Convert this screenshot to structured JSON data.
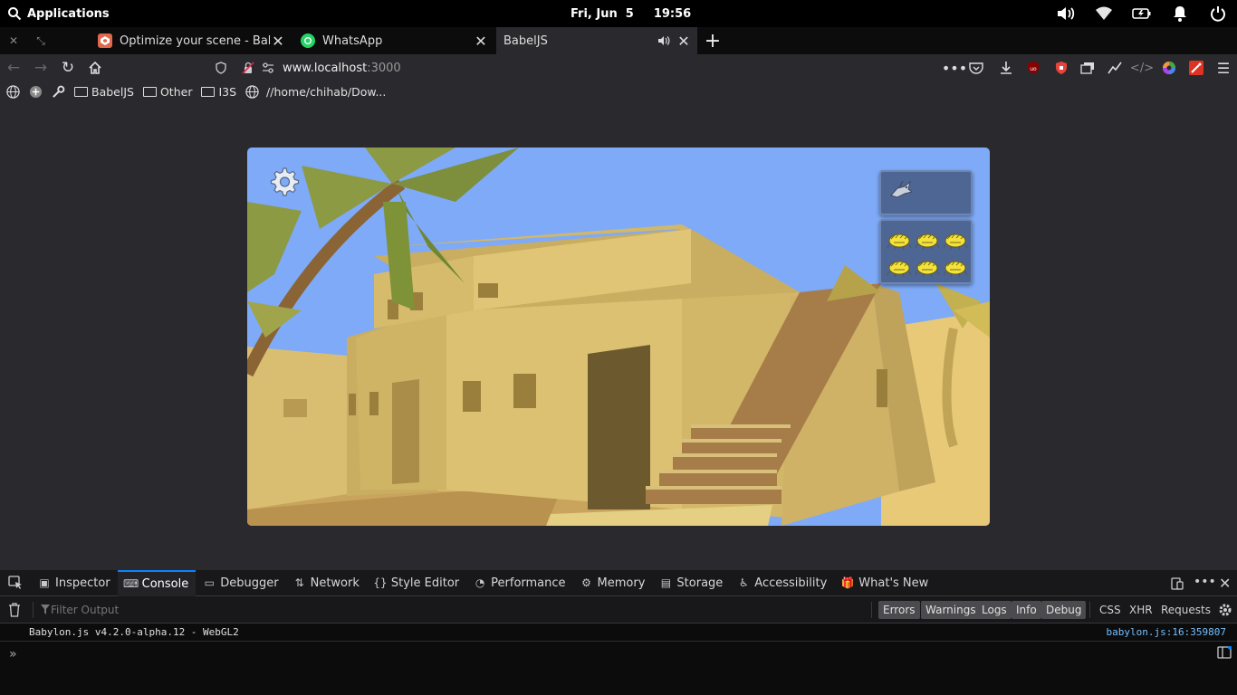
{
  "system_bar": {
    "apps_label": "Applications",
    "date": "Fri, Jun  5",
    "time": "19:56",
    "tray": [
      "volume-icon",
      "wifi-icon",
      "battery-icon",
      "notifications-icon",
      "power-icon"
    ]
  },
  "tabs": [
    {
      "title": "Optimize your scene - Babylon",
      "favicon": "babylon-icon",
      "favicon_color": "#e0684b"
    },
    {
      "title": "WhatsApp",
      "favicon": "whatsapp-icon",
      "favicon_color": "#25d366"
    },
    {
      "title": "BabelJS",
      "favicon": "",
      "active": true,
      "audio": true
    }
  ],
  "address_bar": {
    "host": "www.localhost",
    "port": ":3000"
  },
  "bookmarks": [
    {
      "label": "BabelJS",
      "type": "folder"
    },
    {
      "label": "Other",
      "type": "folder"
    },
    {
      "label": "I3S",
      "type": "folder"
    },
    {
      "label": "//home/chihab/Dow...",
      "type": "link"
    }
  ],
  "game": {
    "sky_color": "#7eaaf8",
    "wall_color": "#d4bc6a",
    "inventory": {
      "top_item": "bird-icon",
      "items": [
        "hay-icon",
        "hay-icon",
        "hay-icon",
        "hay-icon",
        "hay-icon",
        "hay-icon"
      ]
    }
  },
  "devtools": {
    "tabs": [
      {
        "label": "Inspector",
        "icon": "inspector-icon"
      },
      {
        "label": "Console",
        "icon": "console-icon",
        "selected": true
      },
      {
        "label": "Debugger",
        "icon": "debugger-icon"
      },
      {
        "label": "Network",
        "icon": "network-icon"
      },
      {
        "label": "Style Editor",
        "icon": "style-editor-icon"
      },
      {
        "label": "Performance",
        "icon": "performance-icon"
      },
      {
        "label": "Memory",
        "icon": "memory-icon"
      },
      {
        "label": "Storage",
        "icon": "storage-icon"
      },
      {
        "label": "Accessibility",
        "icon": "accessibility-icon"
      },
      {
        "label": "What's New",
        "icon": "whats-new-icon"
      }
    ],
    "filter_placeholder": "Filter Output",
    "filter_buttons": [
      "Errors",
      "Warnings",
      "Logs",
      "Info",
      "Debug"
    ],
    "filter_types": [
      "CSS",
      "XHR",
      "Requests"
    ],
    "log": {
      "message": "Babylon.js v4.2.0-alpha.12 - WebGL2",
      "source": "babylon.js:16:359807"
    },
    "accent": "#0a84ff"
  }
}
